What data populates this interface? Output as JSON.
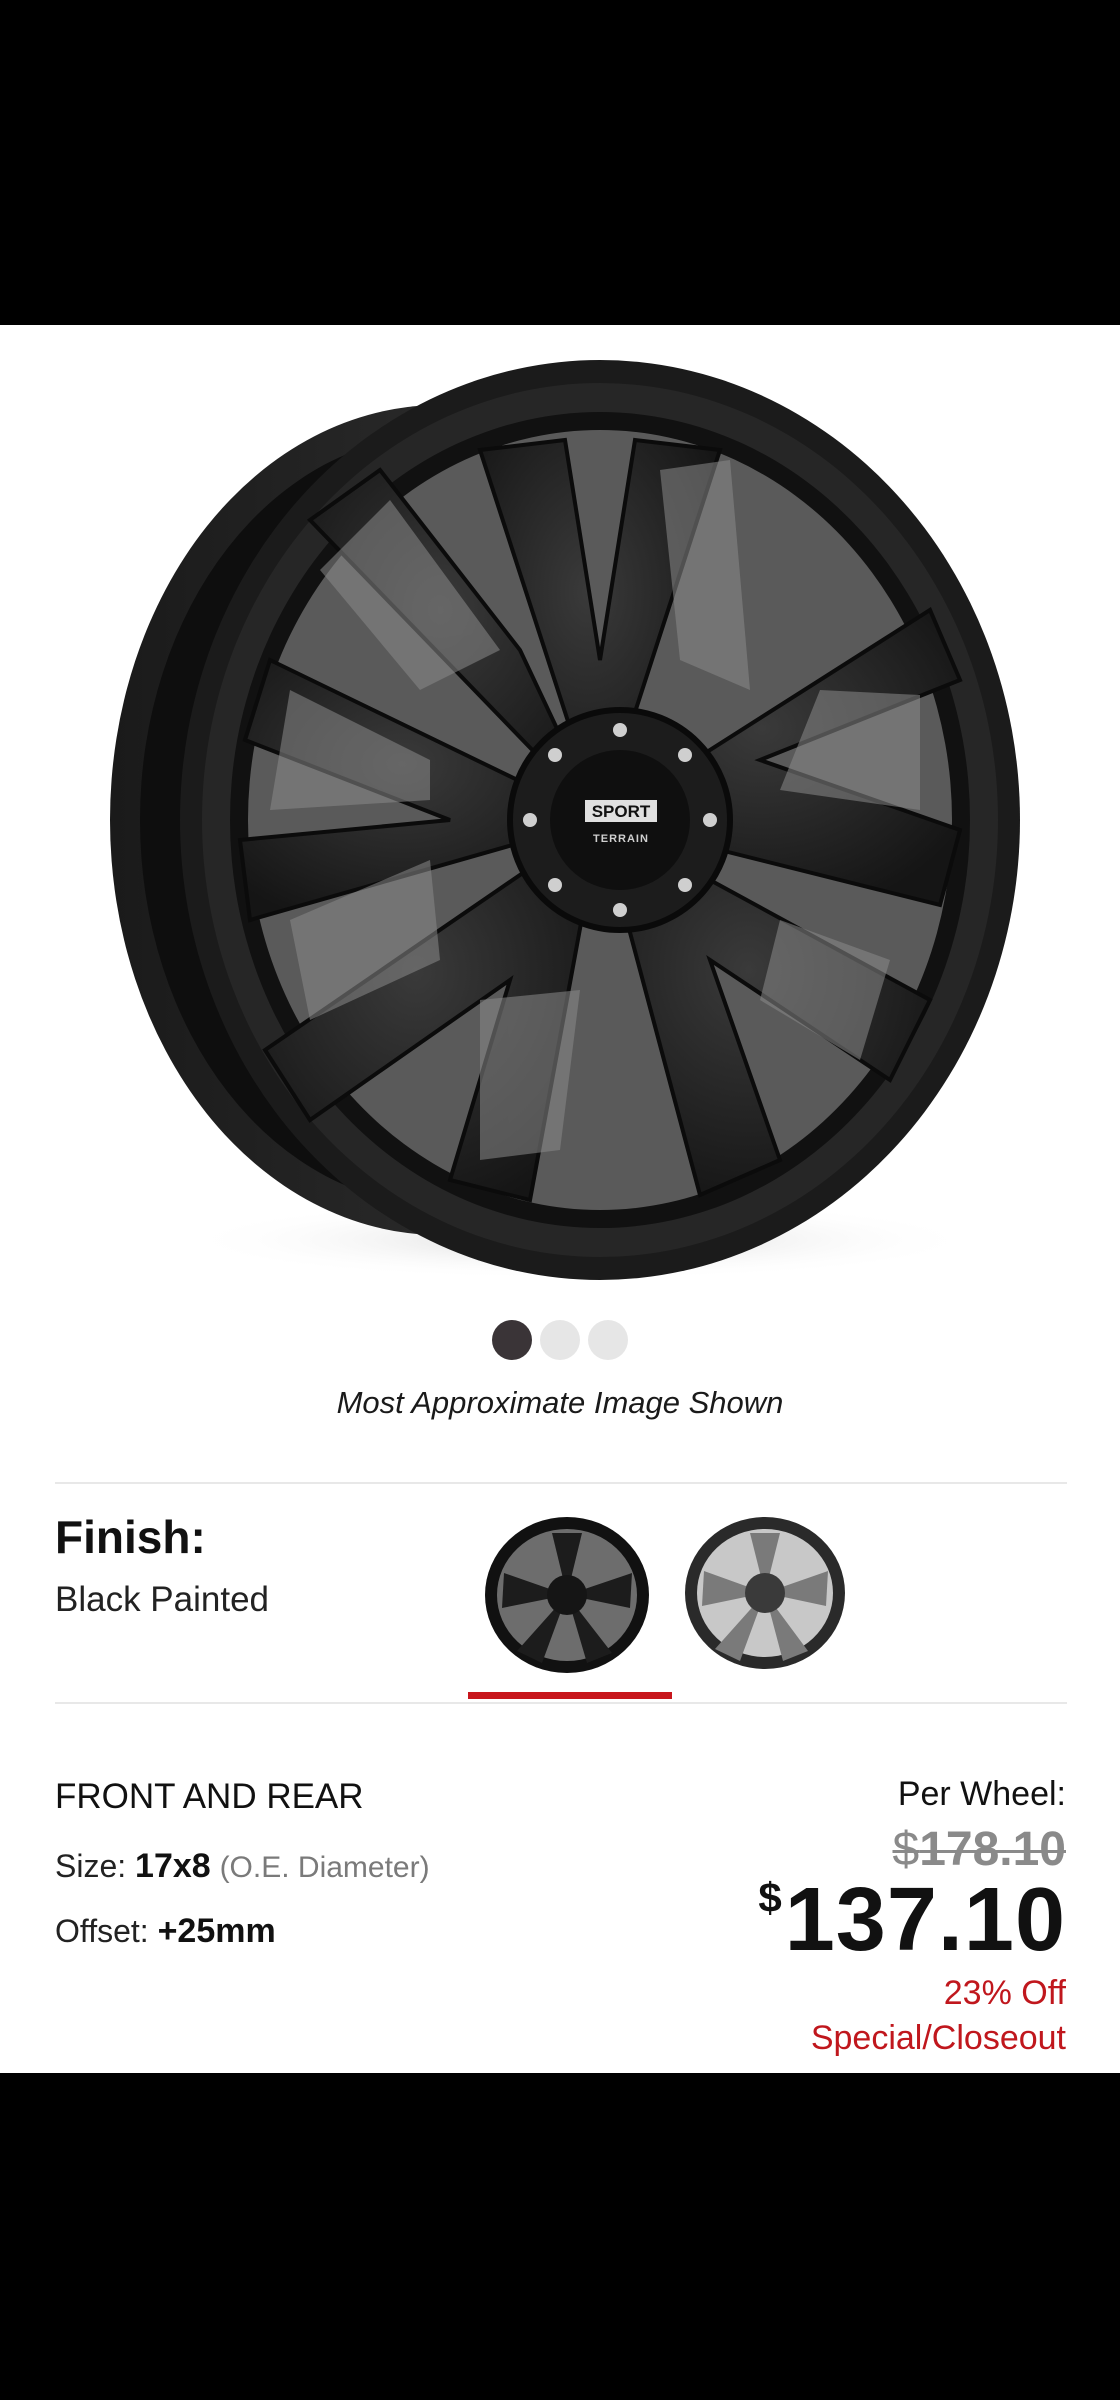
{
  "gallery": {
    "dots_total": 3,
    "active_dot": 1,
    "caption": "Most Approximate Image Shown",
    "wheel_logo_line1": "SPORT",
    "wheel_logo_line2": "TERRAIN"
  },
  "finish": {
    "label": "Finish:",
    "value": "Black Painted",
    "options": [
      {
        "name": "black-painted-swatch",
        "selected": true
      },
      {
        "name": "gunmetal-swatch",
        "selected": false
      }
    ]
  },
  "specs": {
    "position": "FRONT AND REAR",
    "size_label": "Size:",
    "size_value": "17x8",
    "size_note": "(O.E. Diameter)",
    "offset_label": "Offset:",
    "offset_value": "+25mm"
  },
  "price": {
    "per_wheel_label": "Per Wheel:",
    "currency": "$",
    "old_amount": "178.10",
    "new_amount": "137.10",
    "discount": "23% Off",
    "tag": "Special/Closeout"
  },
  "colors": {
    "accent_red": "#c0171d",
    "dot_active": "#3a3437",
    "dot_inactive": "#e6e6e6"
  }
}
